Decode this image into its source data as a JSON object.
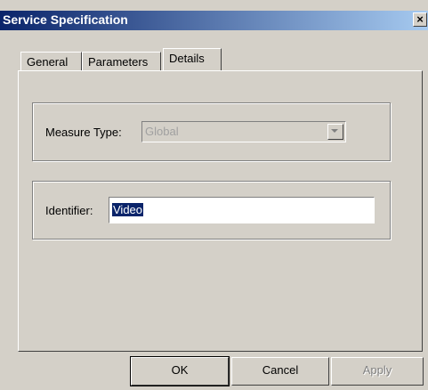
{
  "window": {
    "title": "Service Specification",
    "close_glyph": "×"
  },
  "tabs": [
    {
      "label": "General"
    },
    {
      "label": "Parameters"
    },
    {
      "label": "Details",
      "active": true
    }
  ],
  "measure": {
    "label": "Measure Type:",
    "value": "Global",
    "disabled": true
  },
  "identifier": {
    "label": "Identifier:",
    "value": "Video",
    "selected": true
  },
  "buttons": {
    "ok": "OK",
    "cancel": "Cancel",
    "apply": "Apply"
  },
  "colors": {
    "titlebar_start": "#0a246a",
    "titlebar_end": "#a6caf0",
    "face": "#d4d0c8",
    "selection": "#0a246a"
  },
  "icons": {
    "close": "close-icon",
    "dropdown": "chevron-down-icon"
  }
}
